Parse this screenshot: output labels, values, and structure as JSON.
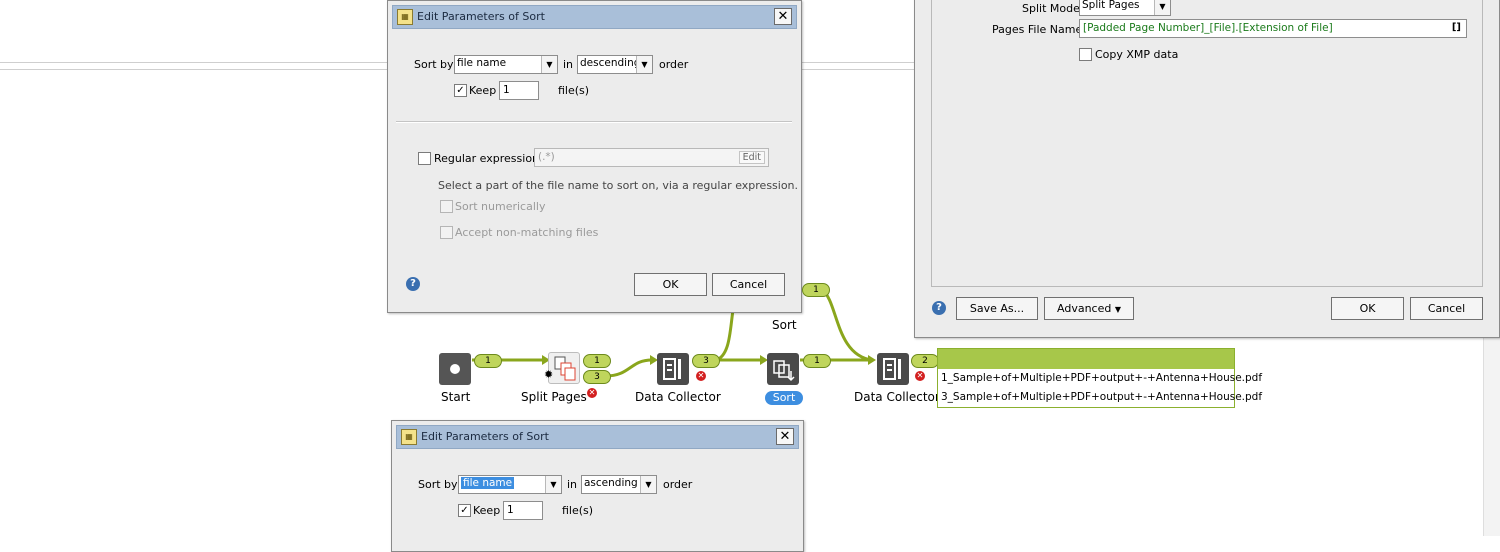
{
  "sort_dialog_top": {
    "title": "Edit Parameters of Sort",
    "sort_by_label": "Sort by",
    "sort_by_value": "file name",
    "in_label": "in",
    "order_value": "descending",
    "order_label": "order",
    "keep_label": "Keep",
    "keep_value": "1",
    "files_label": "file(s)",
    "regex_label": "Regular expression:",
    "regex_value": "(.*)",
    "edit_label": "Edit",
    "regex_help": "Select a part of the file name to sort on, via a regular expression.",
    "sort_numerically": "Sort numerically",
    "accept_nonmatching": "Accept non-matching files",
    "ok": "OK",
    "cancel": "Cancel"
  },
  "split_dialog": {
    "split_mode_label": "Split Mode:",
    "split_mode_value": "Split Pages",
    "pages_file_name_label": "Pages File Name:",
    "pages_file_name_value": "[Padded Page Number]_[File].[Extension of File]",
    "brackets_icon": "[]",
    "copy_xmp_label": "Copy XMP data",
    "save_as": "Save As...",
    "advanced": "Advanced",
    "ok": "OK",
    "cancel": "Cancel"
  },
  "flow": {
    "start_label": "Start",
    "split_pages_label": "Split Pages",
    "data_collector_label": "Data Collector",
    "sort_label": "Sort",
    "sort_top_label": "Sort",
    "data_collector2_label": "Data Collector",
    "badges": {
      "start_out": "1",
      "split_out_top": "1",
      "split_out_bottom": "3",
      "collector_out": "3",
      "sort_top_in": "1",
      "sort_out": "1",
      "collector2_out": "2"
    },
    "files": [
      "1_Sample+of+Multiple+PDF+output+-+Antenna+House.pdf",
      "3_Sample+of+Multiple+PDF+output+-+Antenna+House.pdf"
    ]
  },
  "sort_dialog_bottom": {
    "title": "Edit Parameters of Sort",
    "sort_by_label": "Sort by",
    "sort_by_value": "file name",
    "in_label": "in",
    "order_value": "ascending",
    "order_label": "order",
    "keep_label": "Keep",
    "keep_value": "1",
    "files_label": "file(s)"
  },
  "colors": {
    "connector": "#8aa61c",
    "badge": "#bfd55c",
    "selected_pill": "#3d8ee0",
    "titlebar": "#a9bfd9"
  }
}
